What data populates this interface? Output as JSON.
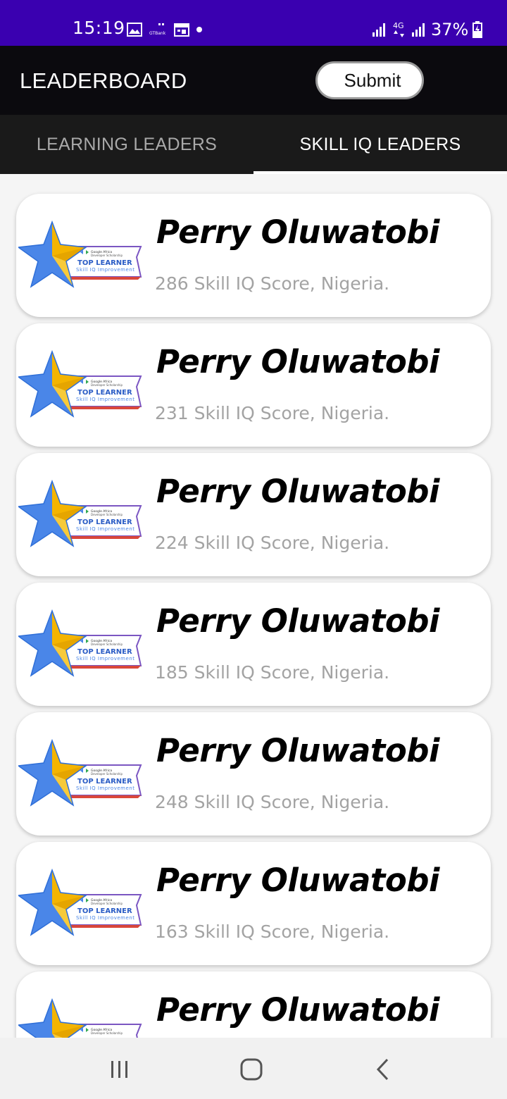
{
  "status_bar": {
    "time": "15:19",
    "battery": "37%",
    "network": "4G",
    "icons": [
      "gallery-icon",
      "gtbank-icon",
      "calendar-icon",
      "notification-dot-icon",
      "signal-icon",
      "network-4g-icon",
      "signal-icon",
      "battery-charging-icon"
    ],
    "gtbank_label": "GTBank"
  },
  "app_bar": {
    "title": "LEADERBOARD",
    "submit_label": "Submit"
  },
  "tabs": [
    {
      "label": "LEARNING LEADERS",
      "selected": false
    },
    {
      "label": "SKILL IQ LEADERS",
      "selected": true
    }
  ],
  "badge": {
    "org": "Google Africa",
    "program": "Developer Scholarship",
    "title": "TOP LEARNER",
    "subtitle": "Skill IQ Improvement"
  },
  "leaders": [
    {
      "name": "Perry Oluwatobi",
      "score_text": "286 Skill IQ Score, Nigeria."
    },
    {
      "name": "Perry Oluwatobi",
      "score_text": "231 Skill IQ Score, Nigeria."
    },
    {
      "name": "Perry Oluwatobi",
      "score_text": "224 Skill IQ Score, Nigeria."
    },
    {
      "name": "Perry Oluwatobi",
      "score_text": "185 Skill IQ Score, Nigeria."
    },
    {
      "name": "Perry Oluwatobi",
      "score_text": "248 Skill IQ Score, Nigeria."
    },
    {
      "name": "Perry Oluwatobi",
      "score_text": "163 Skill IQ Score, Nigeria."
    },
    {
      "name": "Perry Oluwatobi",
      "score_text": ""
    }
  ],
  "nav_bar": {
    "buttons": [
      "recent-apps-icon",
      "home-icon",
      "back-icon"
    ]
  },
  "colors": {
    "status_bar": "#3a00b0",
    "app_bar": "#0b0a0e",
    "tabs": "#1a1a1a",
    "score_text": "#a3a3a3",
    "star_blue": "#4a86e8",
    "star_gold": "#f4b400"
  }
}
